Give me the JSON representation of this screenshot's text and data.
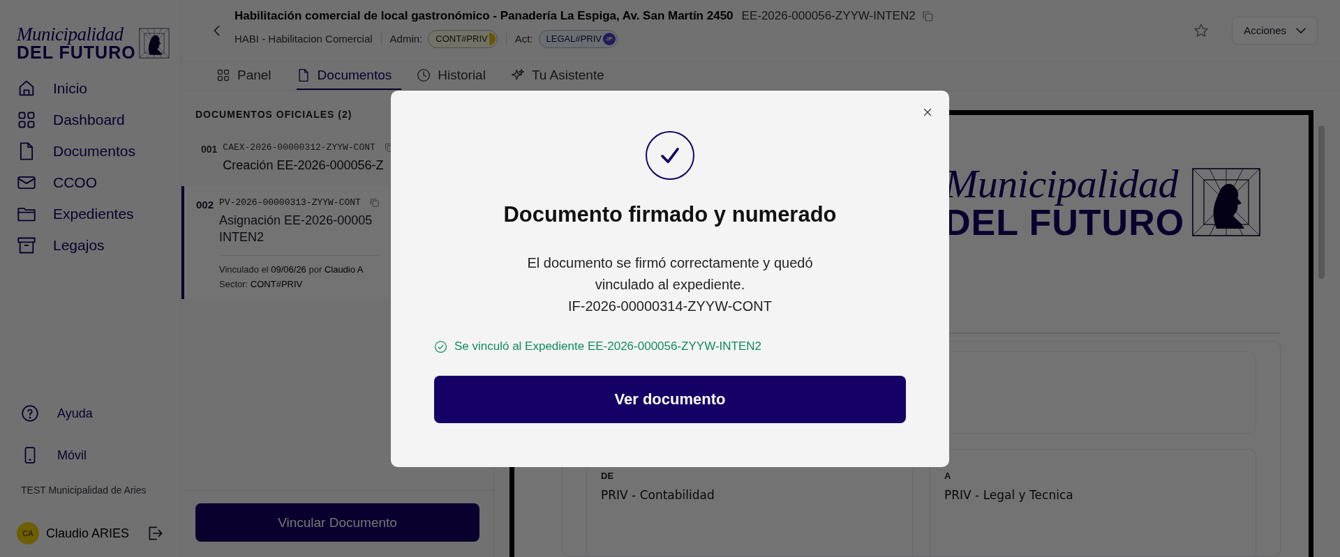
{
  "sidebar": {
    "logo": {
      "script": "Municipalidad",
      "wordmark": "DEL FUTURO"
    },
    "nav": [
      {
        "label": "Inicio",
        "kind": "home"
      },
      {
        "label": "Dashboard",
        "kind": "grid"
      },
      {
        "label": "Documentos",
        "kind": "file"
      },
      {
        "label": "CCOO",
        "kind": "mail"
      },
      {
        "label": "Expedientes",
        "kind": "folder"
      },
      {
        "label": "Legajos",
        "kind": "archive"
      }
    ],
    "footer_nav": [
      {
        "label": "Ayuda",
        "kind": "help"
      },
      {
        "label": "Móvil",
        "kind": "phone"
      }
    ],
    "org": "TEST Municipalidad de Aries",
    "user": {
      "initials": "CA",
      "name": "Claudio ARIES"
    }
  },
  "header": {
    "title": "Habilitación comercial de local gastronómico - Panadería La Espiga, Av. San Martín 2450",
    "code": "EE-2026-000056-ZYYW-INTEN2",
    "subtitle": "HABI - Habilitacion Comercial",
    "admin_label": "Admin:",
    "admin_badge": "CONT#PRIV",
    "act_label": "Act:",
    "act_badge": "LEGAL#PRIV",
    "act_avatar": "JP",
    "actions": "Acciones"
  },
  "tabs": [
    {
      "label": "Panel",
      "kind": "grid",
      "selected": false
    },
    {
      "label": "Documentos",
      "kind": "file",
      "selected": true
    },
    {
      "label": "Historial",
      "kind": "clock",
      "selected": false
    },
    {
      "label": "Tu Asistente",
      "kind": "sparkle",
      "selected": false
    }
  ],
  "documents": {
    "heading": "DOCUMENTOS OFICIALES (2)",
    "items": [
      {
        "number": "001",
        "code": "CAEX-2026-00000312-ZYYW-CONT",
        "title_lines": [
          "Creación EE-2026-000056-Z"
        ],
        "selected": false
      },
      {
        "number": "002",
        "code": "PV-2026-00000313-ZYYW-CONT",
        "title_lines": [
          "Asignación EE-2026-00005",
          "INTEN2"
        ],
        "meta": [
          "Vinculado el **09/06/26** por **Claudio A**",
          "Sector: **CONT#PRIV**"
        ],
        "selected": true
      }
    ],
    "button": "Vincular Documento"
  },
  "preview": {
    "logo": {
      "script": "Municipalidad",
      "wordmark": "DEL FUTURO"
    },
    "from_label": "DE",
    "from": "PRIV - Contabilidad",
    "to_label": "A",
    "to": "PRIV - Legal y Tecnica"
  },
  "dialog": {
    "title": "Documento firmado y numerado",
    "message_lines": [
      "El documento se firmó correctamente y quedó",
      "vinculado al expediente.",
      "IF-2026-00000314-ZYYW-CONT"
    ],
    "notice": "Se vinculó al Expediente EE-2026-000056-ZYYW-INTEN2",
    "button": "Ver documento"
  }
}
